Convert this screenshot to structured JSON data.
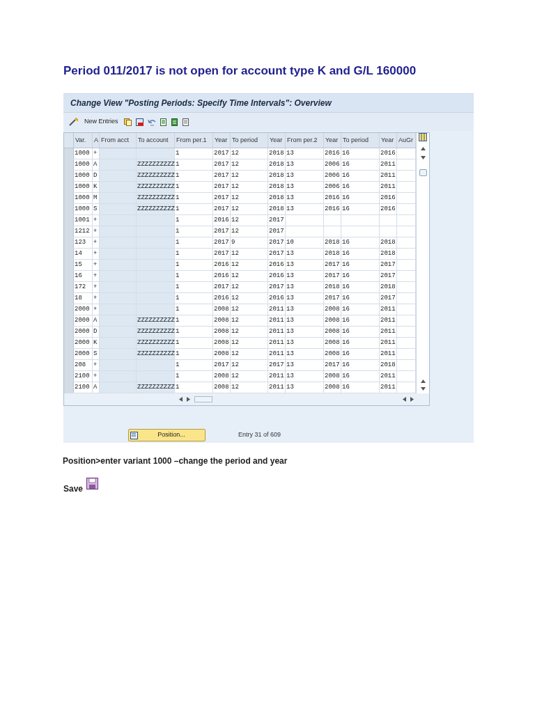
{
  "heading": "Period 011/2017 is not open for account type K and G/L 160000",
  "sap_window": {
    "title": "Change View \"Posting Periods: Specify Time Intervals\": Overview",
    "toolbar": {
      "new_entries": "New Entries"
    },
    "table": {
      "columns": [
        "Var.",
        "A",
        "From acct",
        "To account",
        "From per.1",
        "Year",
        "To period",
        "Year",
        "From per.2",
        "Year",
        "To period",
        "Year",
        "AuGr"
      ],
      "rows": [
        {
          "var": "1000",
          "a": "+",
          "from_per_1": "1",
          "year_1": "2017",
          "to_period_1": "12",
          "year_2": "2018",
          "from_per_2": "13",
          "year_3": "2016",
          "to_period_2": "16",
          "year_4": "2016"
        },
        {
          "var": "1000",
          "a": "A",
          "to_account": "ZZZZZZZZZZ",
          "from_per_1": "1",
          "year_1": "2017",
          "to_period_1": "12",
          "year_2": "2018",
          "from_per_2": "13",
          "year_3": "2006",
          "to_period_2": "16",
          "year_4": "2011"
        },
        {
          "var": "1000",
          "a": "D",
          "to_account": "ZZZZZZZZZZ",
          "from_per_1": "1",
          "year_1": "2017",
          "to_period_1": "12",
          "year_2": "2018",
          "from_per_2": "13",
          "year_3": "2006",
          "to_period_2": "16",
          "year_4": "2011"
        },
        {
          "var": "1000",
          "a": "K",
          "to_account": "ZZZZZZZZZZ",
          "from_per_1": "1",
          "year_1": "2017",
          "to_period_1": "12",
          "year_2": "2018",
          "from_per_2": "13",
          "year_3": "2006",
          "to_period_2": "16",
          "year_4": "2011"
        },
        {
          "var": "1000",
          "a": "M",
          "to_account": "ZZZZZZZZZZ",
          "from_per_1": "1",
          "year_1": "2017",
          "to_period_1": "12",
          "year_2": "2018",
          "from_per_2": "13",
          "year_3": "2016",
          "to_period_2": "16",
          "year_4": "2016"
        },
        {
          "var": "1000",
          "a": "S",
          "to_account": "ZZZZZZZZZZ",
          "from_per_1": "1",
          "year_1": "2017",
          "to_period_1": "12",
          "year_2": "2018",
          "from_per_2": "13",
          "year_3": "2016",
          "to_period_2": "16",
          "year_4": "2016"
        },
        {
          "var": "1001",
          "a": "+",
          "from_per_1": "1",
          "year_1": "2016",
          "to_period_1": "12",
          "year_2": "2017"
        },
        {
          "var": "1212",
          "a": "+",
          "from_per_1": "1",
          "year_1": "2017",
          "to_period_1": "12",
          "year_2": "2017"
        },
        {
          "var": "123",
          "a": "+",
          "from_per_1": "1",
          "year_1": "2017",
          "to_period_1": "9",
          "year_2": "2017",
          "from_per_2": "10",
          "year_3": "2018",
          "to_period_2": "16",
          "year_4": "2018"
        },
        {
          "var": "14",
          "a": "+",
          "from_per_1": "1",
          "year_1": "2017",
          "to_period_1": "12",
          "year_2": "2017",
          "from_per_2": "13",
          "year_3": "2018",
          "to_period_2": "16",
          "year_4": "2018"
        },
        {
          "var": "15",
          "a": "+",
          "from_per_1": "1",
          "year_1": "2016",
          "to_period_1": "12",
          "year_2": "2016",
          "from_per_2": "13",
          "year_3": "2017",
          "to_period_2": "16",
          "year_4": "2017"
        },
        {
          "var": "16",
          "a": "+",
          "from_per_1": "1",
          "year_1": "2016",
          "to_period_1": "12",
          "year_2": "2016",
          "from_per_2": "13",
          "year_3": "2017",
          "to_period_2": "16",
          "year_4": "2017"
        },
        {
          "var": "172",
          "a": "+",
          "from_per_1": "1",
          "year_1": "2017",
          "to_period_1": "12",
          "year_2": "2017",
          "from_per_2": "13",
          "year_3": "2018",
          "to_period_2": "16",
          "year_4": "2018"
        },
        {
          "var": "18",
          "a": "+",
          "from_per_1": "1",
          "year_1": "2016",
          "to_period_1": "12",
          "year_2": "2016",
          "from_per_2": "13",
          "year_3": "2017",
          "to_period_2": "16",
          "year_4": "2017"
        },
        {
          "var": "2000",
          "a": "+",
          "from_per_1": "1",
          "year_1": "2008",
          "to_period_1": "12",
          "year_2": "2011",
          "from_per_2": "13",
          "year_3": "2008",
          "to_period_2": "16",
          "year_4": "2011"
        },
        {
          "var": "2000",
          "a": "A",
          "to_account": "ZZZZZZZZZZ",
          "from_per_1": "1",
          "year_1": "2008",
          "to_period_1": "12",
          "year_2": "2011",
          "from_per_2": "13",
          "year_3": "2008",
          "to_period_2": "16",
          "year_4": "2011"
        },
        {
          "var": "2000",
          "a": "D",
          "to_account": "ZZZZZZZZZZ",
          "from_per_1": "1",
          "year_1": "2008",
          "to_period_1": "12",
          "year_2": "2011",
          "from_per_2": "13",
          "year_3": "2008",
          "to_period_2": "16",
          "year_4": "2011"
        },
        {
          "var": "2000",
          "a": "K",
          "to_account": "ZZZZZZZZZZ",
          "from_per_1": "1",
          "year_1": "2008",
          "to_period_1": "12",
          "year_2": "2011",
          "from_per_2": "13",
          "year_3": "2008",
          "to_period_2": "16",
          "year_4": "2011"
        },
        {
          "var": "2000",
          "a": "S",
          "to_account": "ZZZZZZZZZZ",
          "from_per_1": "1",
          "year_1": "2008",
          "to_period_1": "12",
          "year_2": "2011",
          "from_per_2": "13",
          "year_3": "2008",
          "to_period_2": "16",
          "year_4": "2011"
        },
        {
          "var": "208",
          "a": "+",
          "from_per_1": "1",
          "year_1": "2017",
          "to_period_1": "12",
          "year_2": "2017",
          "from_per_2": "13",
          "year_3": "2017",
          "to_period_2": "16",
          "year_4": "2018"
        },
        {
          "var": "2100",
          "a": "+",
          "from_per_1": "1",
          "year_1": "2008",
          "to_period_1": "12",
          "year_2": "2011",
          "from_per_2": "13",
          "year_3": "2008",
          "to_period_2": "16",
          "year_4": "2011"
        },
        {
          "var": "2100",
          "a": "A",
          "to_account": "ZZZZZZZZZZ",
          "from_per_1": "1",
          "year_1": "2008",
          "to_period_1": "12",
          "year_2": "2011",
          "from_per_2": "13",
          "year_3": "2008",
          "to_period_2": "16",
          "year_4": "2011"
        }
      ]
    },
    "position_button": "Position...",
    "entry_info": "Entry 31 of 609"
  },
  "instruction": "Position>enter variant 1000 –change the period and year",
  "save_label": "Save"
}
